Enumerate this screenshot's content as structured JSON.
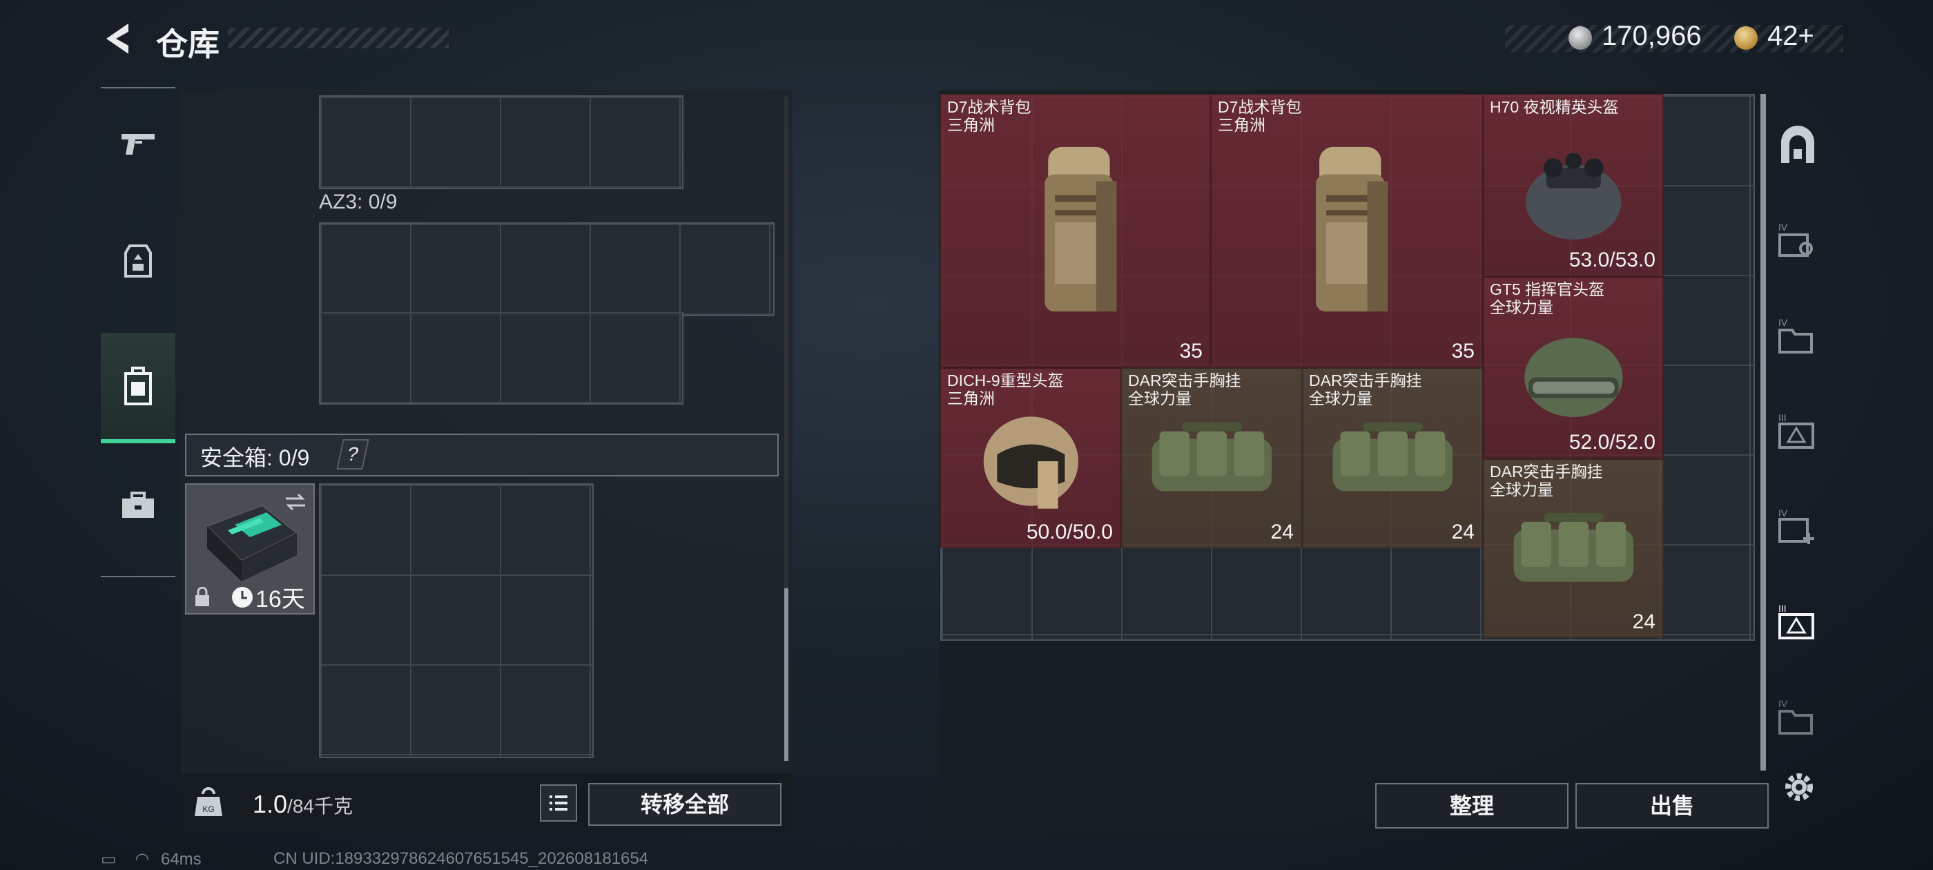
{
  "header": {
    "title": "仓库",
    "currency_silver": "170,966",
    "currency_gold": "42+"
  },
  "left_tabs": [
    {
      "icon": "pistol-icon"
    },
    {
      "icon": "armor-vest-icon"
    },
    {
      "icon": "backpack-icon",
      "selected": true
    },
    {
      "icon": "briefcase-icon"
    }
  ],
  "containers": {
    "az3_label": "AZ3: 0/9",
    "safe_label": "安全箱: 0/9",
    "safe_help": "?",
    "case_days": "16天"
  },
  "footer_left": {
    "weight_current": "1.0",
    "weight_total": "/84千克",
    "transfer_all": "转移全部"
  },
  "items": [
    {
      "name": "D7战术背包",
      "sub": "三角洲",
      "value": "35",
      "color": "red",
      "kind": "backpack"
    },
    {
      "name": "D7战术背包",
      "sub": "三角洲",
      "value": "35",
      "color": "red",
      "kind": "backpack"
    },
    {
      "name": "H70 夜视精英头盔",
      "sub": "",
      "value": "53.0/53.0",
      "color": "red",
      "kind": "helmet-nv"
    },
    {
      "name": "GT5 指挥官头盔",
      "sub": "全球力量",
      "value": "52.0/52.0",
      "color": "red",
      "kind": "helmet-gt5"
    },
    {
      "name": "DICH-9重型头盔",
      "sub": "三角洲",
      "value": "50.0/50.0",
      "color": "red",
      "kind": "helmet-heavy"
    },
    {
      "name": "DAR突击手胸挂",
      "sub": "全球力量",
      "value": "24",
      "color": "tan",
      "kind": "rig"
    },
    {
      "name": "DAR突击手胸挂",
      "sub": "全球力量",
      "value": "24",
      "color": "tan",
      "kind": "rig"
    },
    {
      "name": "DAR突击手胸挂",
      "sub": "全球力量",
      "value": "24",
      "color": "tan",
      "kind": "rig"
    }
  ],
  "right_tabs": [
    "vault-icon",
    "box-search-icon",
    "folder-icon",
    "tier-box-icon",
    "box-add-icon",
    "tier-box-selected-icon",
    "folder-lock-icon"
  ],
  "footer_right": {
    "sort": "整理",
    "sell": "出售"
  },
  "status": {
    "ping": "64ms",
    "uid": "CN UID:189332978624607651545_202608181654"
  },
  "colors": {
    "accent_green": "#3fd39a",
    "item_red": "#7a2a34",
    "item_tan": "#5c4838"
  }
}
